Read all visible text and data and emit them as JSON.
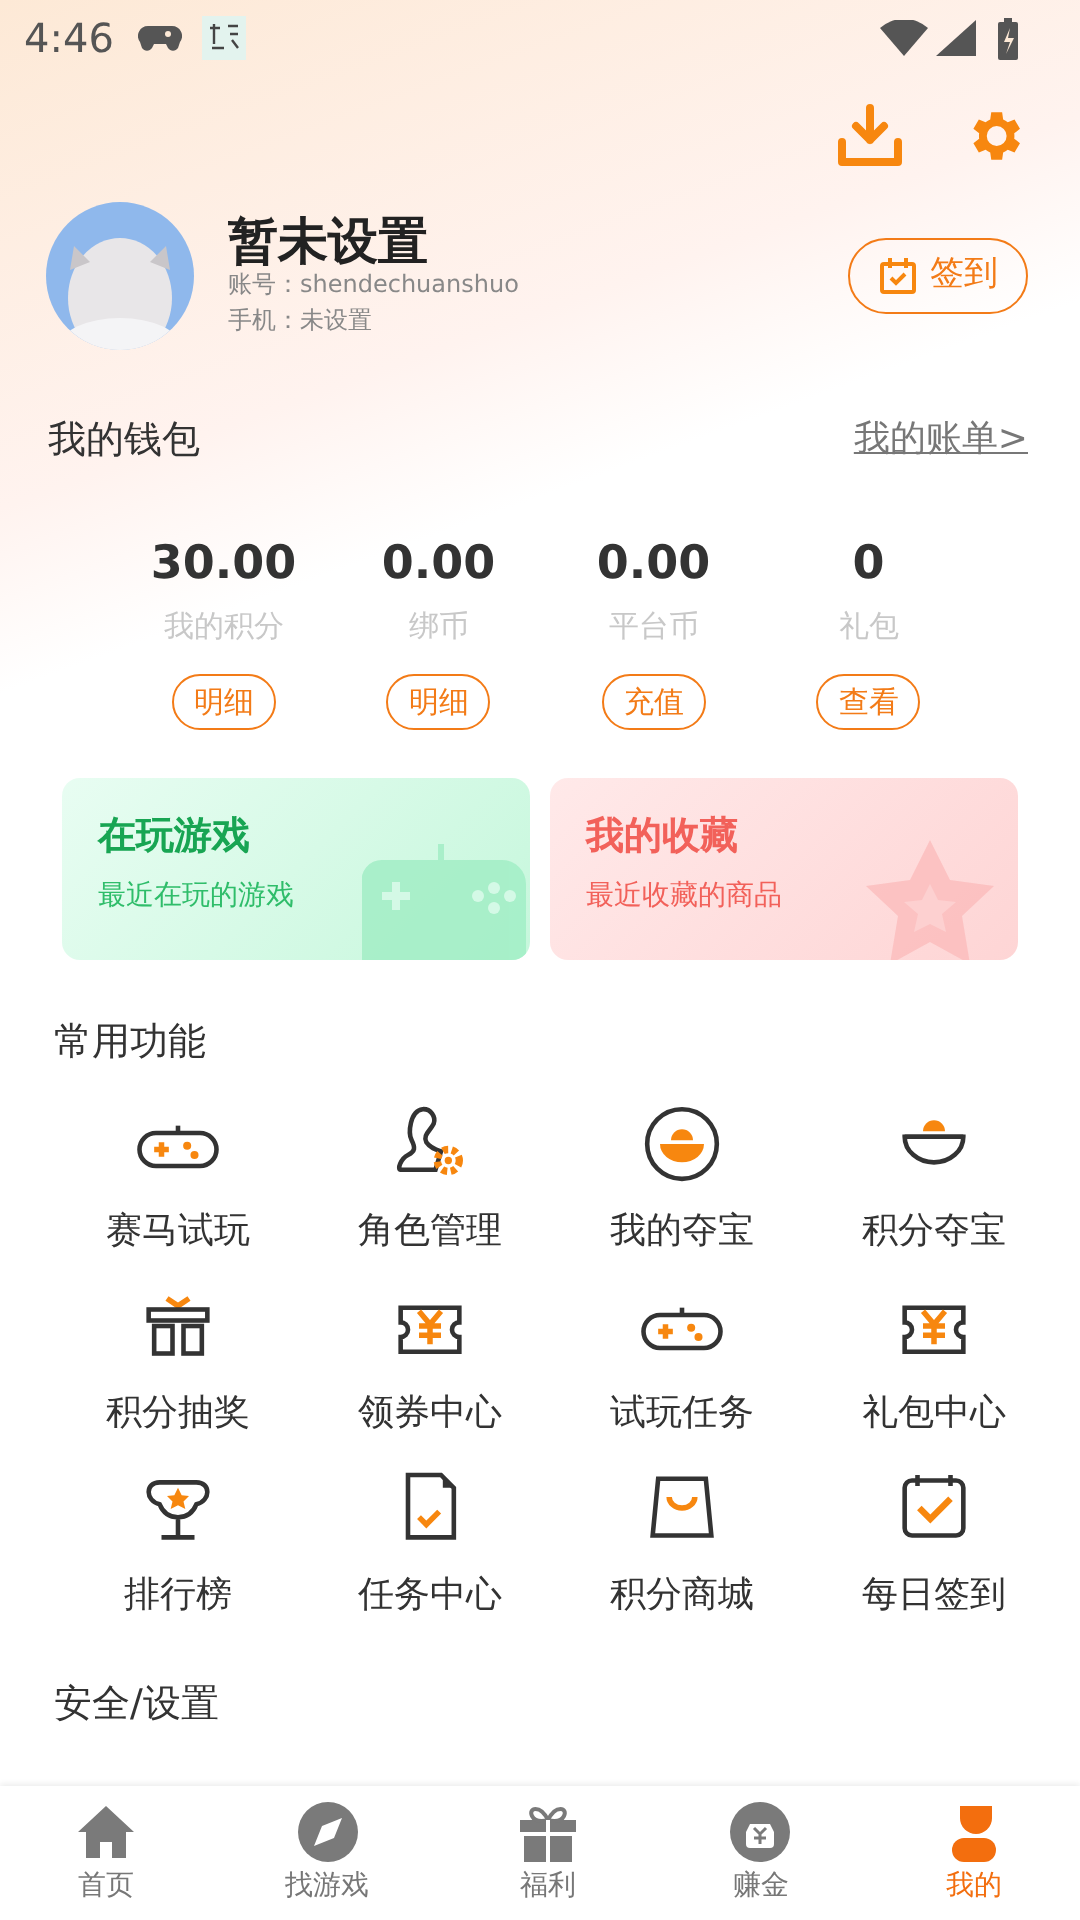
{
  "status_bar": {
    "time": "4:46"
  },
  "profile": {
    "name": "暂未设置",
    "account": "账号：shendechuanshuo",
    "phone": "手机：未设置",
    "checkin_button": "签到"
  },
  "wallet": {
    "title": "我的钱包",
    "link": "我的账单>",
    "stats": [
      {
        "value": "30.00",
        "label": "我的积分",
        "button": "明细"
      },
      {
        "value": "0.00",
        "label": "绑币",
        "button": "明细"
      },
      {
        "value": "0.00",
        "label": "平台币",
        "button": "充值"
      },
      {
        "value": "0",
        "label": "礼包",
        "button": "查看"
      }
    ]
  },
  "cards": [
    {
      "kind": "games",
      "title": "在玩游戏",
      "subtitle": "最近在玩的游戏"
    },
    {
      "kind": "favorites",
      "title": "我的收藏",
      "subtitle": "最近收藏的商品"
    }
  ],
  "functions": {
    "title": "常用功能",
    "items": [
      {
        "label": "赛马试玩"
      },
      {
        "label": "角色管理"
      },
      {
        "label": "我的夺宝"
      },
      {
        "label": "积分夺宝"
      },
      {
        "label": "积分抽奖"
      },
      {
        "label": "领券中心"
      },
      {
        "label": "试玩任务"
      },
      {
        "label": "礼包中心"
      },
      {
        "label": "排行榜"
      },
      {
        "label": "任务中心"
      },
      {
        "label": "积分商城"
      },
      {
        "label": "每日签到"
      }
    ]
  },
  "next_section": {
    "title": "安全/设置"
  },
  "nav": [
    {
      "label": "首页",
      "selected": false
    },
    {
      "label": "找游戏",
      "selected": false
    },
    {
      "label": "福利",
      "selected": false
    },
    {
      "label": "赚金",
      "selected": false
    },
    {
      "label": "我的",
      "selected": true
    }
  ]
}
